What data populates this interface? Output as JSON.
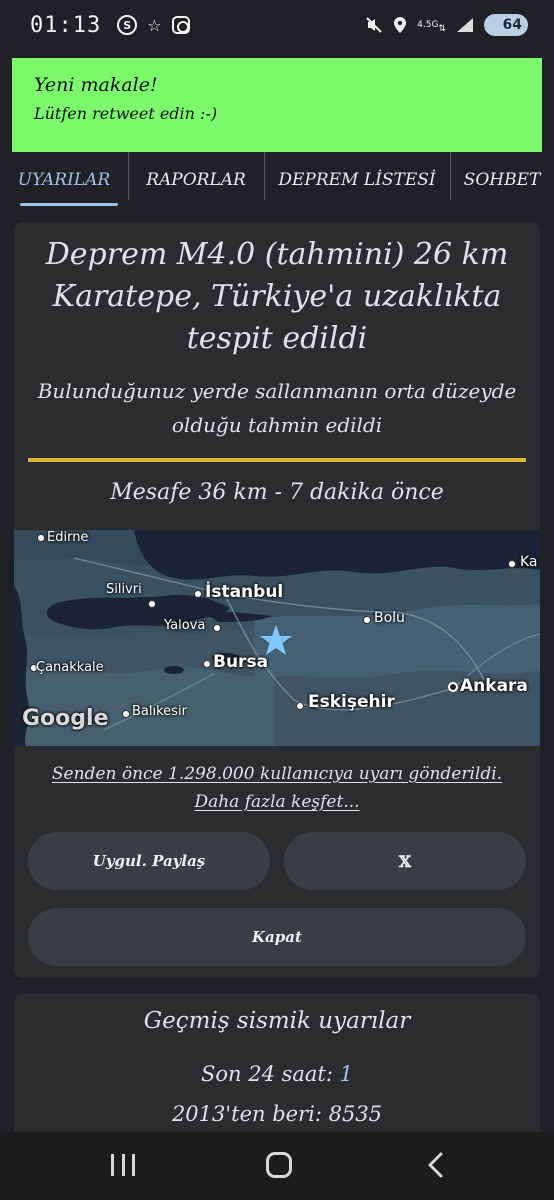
{
  "status": {
    "time": "01:13",
    "left_icons": [
      "s-circle-icon",
      "star-outline-icon",
      "instagram-icon"
    ],
    "network": "4.5G",
    "battery": "64"
  },
  "banner": {
    "title": "Yeni makale!",
    "subtitle": "Lütfen retweet edin :-)",
    "color": "#7cf86c"
  },
  "tabs": [
    {
      "label": "UYARILAR",
      "active": true
    },
    {
      "label": "RAPORLAR",
      "active": false
    },
    {
      "label": "DEPREM LİSTESİ",
      "active": false
    },
    {
      "label": "SOHBET",
      "active": false
    }
  ],
  "alert": {
    "title": "Deprem M4.0 (tahmini) 26 km Karatepe, Türkiye'a uzaklıkta tespit edildi",
    "shaking": "Bulunduğunuz yerde sallanmanın orta düzeyde olduğu tahmin edildi",
    "distance": "Mesafe 36 km - 7 dakika önce",
    "accent_line_color": "#d8b43a",
    "users_link": "Senden önce 1.298.000 kullanıcıya uyarı gönderildi. Daha fazla keşfet..."
  },
  "map": {
    "cities": {
      "edirne": "Edirne",
      "silivri": "Silivri",
      "istanbul": "İstanbul",
      "yalova": "Yalova",
      "bolu": "Bolu",
      "canakkale": "Çanakkale",
      "bursa": "Bursa",
      "eskisehir": "Eskişehir",
      "ankara": "Ankara",
      "balikesir": "Balıkesir",
      "ka": "Ka"
    },
    "logo": "Google",
    "epicenter_icon": "star-icon",
    "epicenter_color": "#7fc7ff"
  },
  "buttons": {
    "share": "Uygul. Paylaş",
    "x": "𝕏",
    "close": "Kapat"
  },
  "history": {
    "title": "Geçmiş sismik uyarılar",
    "last24_label": "Son 24 saat: ",
    "last24_value": "1",
    "since2013": "2013'ten beri: 8535"
  },
  "navbar": {
    "icons": [
      "recents-icon",
      "home-icon",
      "back-icon"
    ]
  }
}
